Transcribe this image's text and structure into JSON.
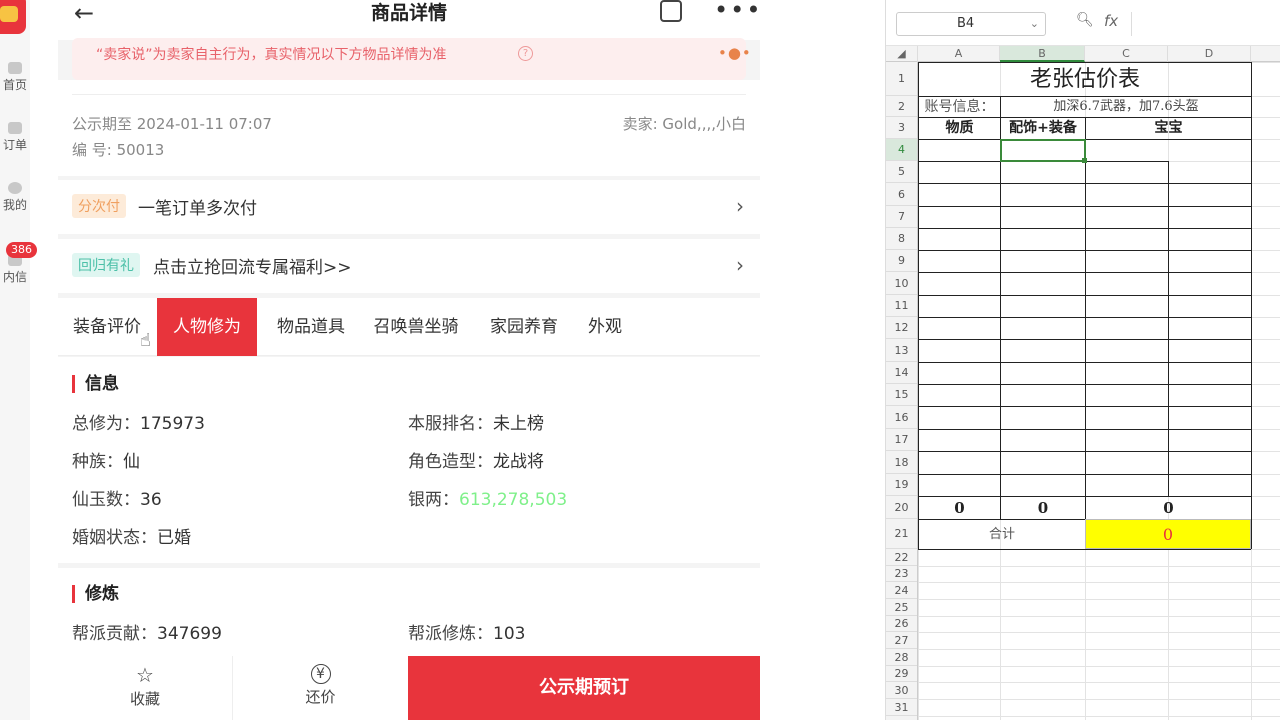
{
  "left_nav": {
    "items": [
      {
        "label": "首页"
      },
      {
        "label": "订单"
      },
      {
        "label": "我的"
      },
      {
        "label": "内信"
      }
    ],
    "badge": "386"
  },
  "header": {
    "title": "商品详情",
    "back_icon": "arrow-left-icon",
    "share_icon": "share-icon",
    "more_icon": "more-icon"
  },
  "notice": {
    "text": "“卖家说”为卖家自主行为，真实情况以下方物品详情为准",
    "help_icon": "?"
  },
  "item_info": {
    "publicity": "公示期至 2024-01-11 07:07",
    "seller": "卖家: Gold,,,,小白",
    "number": "编 号: 50013"
  },
  "installment": {
    "tag": "分次付",
    "text": "一笔订单多次付"
  },
  "return_gift": {
    "tag": "回归有礼",
    "text": "点击立抢回流专属福利>>"
  },
  "tabs": [
    {
      "label": "装备评价"
    },
    {
      "label": "人物修为"
    },
    {
      "label": "物品道具"
    },
    {
      "label": "召唤兽坐骑"
    },
    {
      "label": "家园养育"
    },
    {
      "label": "外观"
    }
  ],
  "info_section": {
    "title": "信息",
    "fields": [
      {
        "k": "总修为：",
        "v": "175973"
      },
      {
        "k": "本服排名：",
        "v": "未上榜"
      },
      {
        "k": "种族：",
        "v": "仙"
      },
      {
        "k": "角色造型：",
        "v": "龙战将"
      },
      {
        "k": "仙玉数：",
        "v": "36"
      },
      {
        "k": "银两：",
        "v": "613,278,503"
      },
      {
        "k": "婚姻状态：",
        "v": "已婚"
      }
    ]
  },
  "cultivation_section": {
    "title": "修炼",
    "fields": [
      {
        "k": "帮派贡献：",
        "v": "347699"
      },
      {
        "k": "帮派修炼：",
        "v": "103"
      }
    ]
  },
  "footer": {
    "favorite": "收藏",
    "bargain": "还价",
    "preorder": "公示期预订"
  },
  "spreadsheet": {
    "name_box": "B4",
    "fx": "fx",
    "columns": [
      "A",
      "B",
      "C",
      "D"
    ],
    "rows": [
      "1",
      "2",
      "3",
      "4",
      "5",
      "6",
      "7",
      "8",
      "9",
      "10",
      "11",
      "12",
      "13",
      "14",
      "15",
      "16",
      "17",
      "18",
      "19",
      "20",
      "21",
      "22",
      "23",
      "24",
      "25",
      "26",
      "27",
      "28",
      "29",
      "30",
      "31"
    ],
    "title": "老张估价表",
    "account_label": "账号信息：",
    "account_value": "加深6.7武器，加7.6头盔",
    "header_quality": "物质",
    "header_accessory": "配饰+装备",
    "header_pet": "宝宝",
    "sum_a": "0",
    "sum_b": "0",
    "sum_c": "0",
    "total_label": "合计",
    "total_value": "0"
  },
  "colors": {
    "accent": "#e8343c",
    "silver_value": "#7ff08a",
    "total_bg": "#ffff00",
    "total_text": "#e8343c"
  }
}
